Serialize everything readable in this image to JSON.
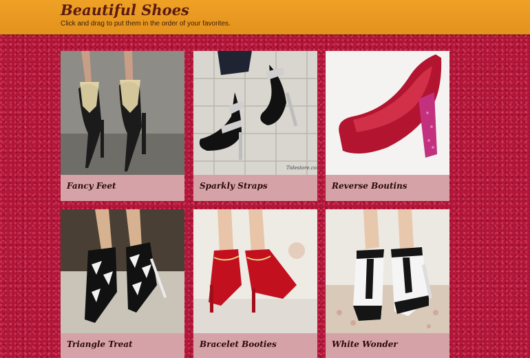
{
  "header": {
    "title": "Beautiful Shoes",
    "subtitle": "Click and drag to put them in the order of your favorites."
  },
  "cards": [
    {
      "label": "Fancy Feet",
      "image": "black-heels-jeweled-ankle-photo"
    },
    {
      "label": "Sparkly Straps",
      "image": "black-heels-sparkly-straps-photo",
      "watermark": "Tidestore.com"
    },
    {
      "label": "Reverse Boutins",
      "image": "red-platform-pump-photo"
    },
    {
      "label": "Triangle Treat",
      "image": "black-white-triangle-heels-photo"
    },
    {
      "label": "Bracelet Booties",
      "image": "red-ankle-booties-photo"
    },
    {
      "label": "White Wonder",
      "image": "black-white-tstrap-heels-photo"
    }
  ],
  "colors": {
    "header": "#e89a22",
    "background": "#b5173a",
    "label_bg": "#d5a2a7"
  }
}
